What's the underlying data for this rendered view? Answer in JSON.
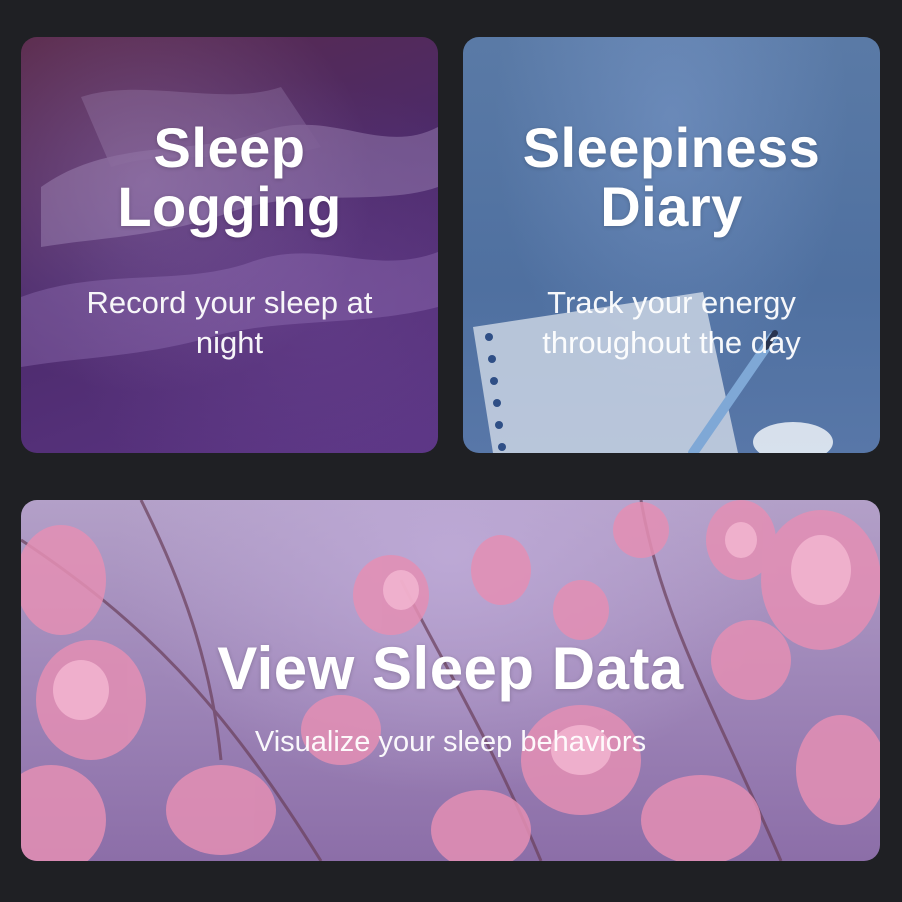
{
  "cards": [
    {
      "title_line1": "Sleep",
      "title_line2": "Logging",
      "subtitle": "Record your sleep at night"
    },
    {
      "title_line1": "Sleepiness",
      "title_line2": "Diary",
      "subtitle": "Track your energy throughout the day"
    },
    {
      "title": "View Sleep Data",
      "subtitle": "Visualize your sleep behaviors"
    }
  ],
  "colors": {
    "page_background": "#1f2024",
    "sleep_logging_tint": "#4c2a6a",
    "sleepiness_diary_tint": "#4f70a0",
    "view_sleep_data_tint": "#9e86b8",
    "text": "#ffffff"
  }
}
